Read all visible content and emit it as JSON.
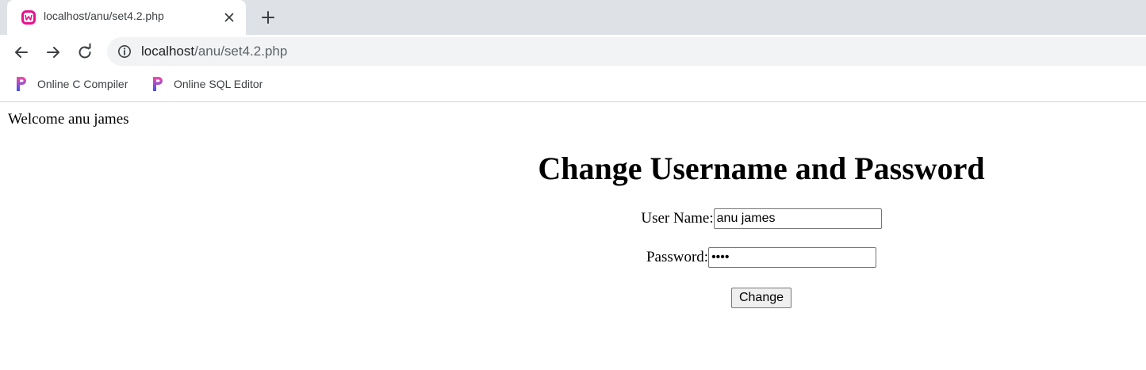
{
  "browser": {
    "tab": {
      "title": "localhost/anu/set4.2.php",
      "favicon": "wampserver-icon"
    },
    "address_bar": {
      "host": "localhost",
      "path": "/anu/set4.2.php"
    },
    "bookmarks": [
      {
        "label": "Online C Compiler",
        "icon": "programiz-icon"
      },
      {
        "label": "Online SQL Editor",
        "icon": "programiz-icon"
      }
    ],
    "colors": {
      "tabstrip": "#dee1e6",
      "omnibox": "#f1f3f4",
      "favicon": "#e8118c",
      "bookmark_icon_top": "#f54aa5",
      "bookmark_icon_bottom": "#3f51f5"
    }
  },
  "page": {
    "welcome_text": "Welcome anu james",
    "heading": "Change Username and Password",
    "form": {
      "username_label": "User Name:",
      "username_value": "anu james",
      "password_label": "Password:",
      "password_value": "1234",
      "submit_label": "Change"
    }
  }
}
